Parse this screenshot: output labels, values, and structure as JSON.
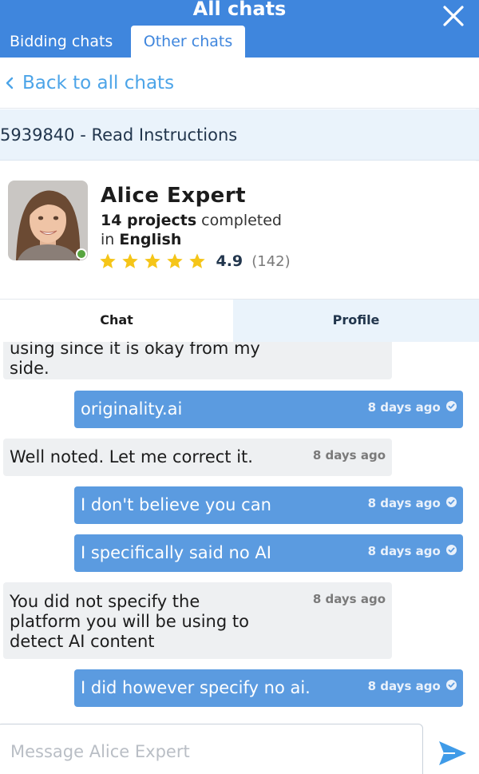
{
  "header": {
    "title": "All chats",
    "tabs": [
      "Bidding chats",
      "Other chats"
    ],
    "active_tab": "Other chats"
  },
  "nav": {
    "back_label": "Back to all chats"
  },
  "project": {
    "label": "5939840 - Read Instructions"
  },
  "expert": {
    "name": "Alice Expert",
    "projects_count": "14 projects",
    "projects_suffix": " completed",
    "language_prefix": "in ",
    "language": "English",
    "rating": "4.9",
    "reviews": "(142)",
    "stars": 5,
    "online": true
  },
  "chat_tabs": {
    "chat": "Chat",
    "profile": "Profile",
    "active": "Chat"
  },
  "messages": [
    {
      "direction": "in",
      "text": "using since it is okay from my\nside.",
      "time": ""
    },
    {
      "direction": "out",
      "text": "originality.ai",
      "time": "8 days ago"
    },
    {
      "direction": "in",
      "text": "Well noted. Let me correct it.",
      "time": "8 days ago"
    },
    {
      "direction": "out",
      "text": "I don't believe you can",
      "time": "8 days ago"
    },
    {
      "direction": "out",
      "text": "I specifically said no AI",
      "time": "8 days ago"
    },
    {
      "direction": "in",
      "text": "You did not specify the\nplatform you will be using to\ndetect AI content",
      "time": "8 days ago"
    },
    {
      "direction": "out",
      "text": "I did however specify no ai.",
      "time": "8 days ago"
    }
  ],
  "composer": {
    "placeholder": "Message Alice Expert"
  },
  "colors": {
    "brand": "#3f86dd",
    "link": "#4ca4e8",
    "outgoing_bubble": "#5b9be0",
    "incoming_bubble": "#eef0f2",
    "star": "#f5c518",
    "online": "#57a53f"
  }
}
